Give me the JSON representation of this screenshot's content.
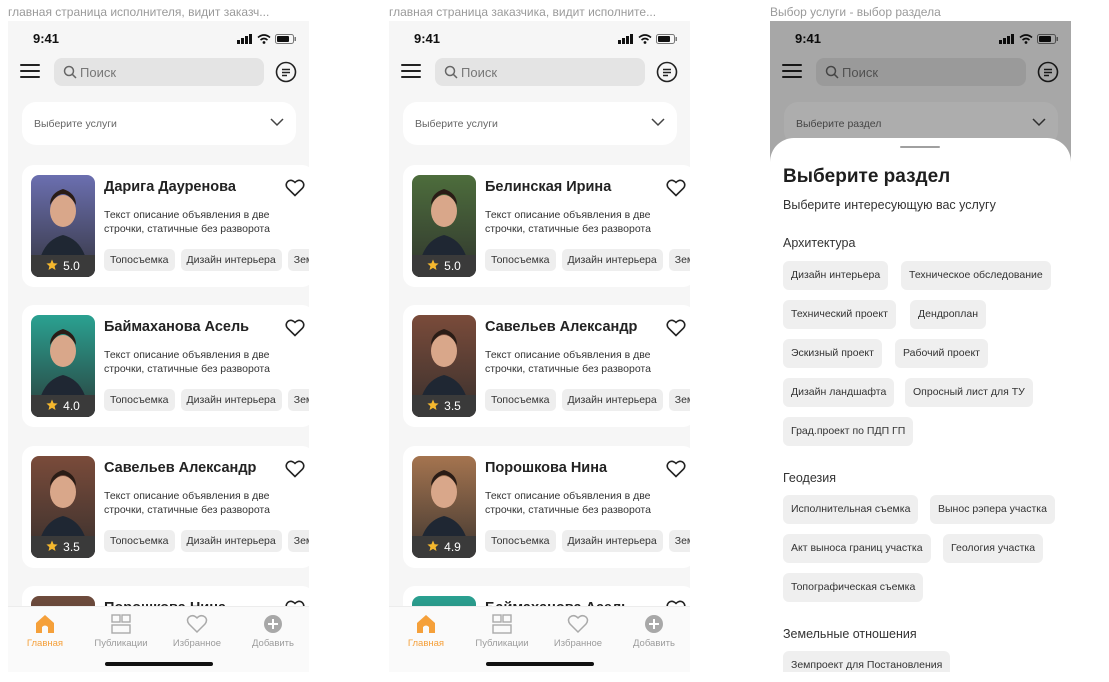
{
  "frames": [
    {
      "title": "главная страница исполнителя, видит заказч..."
    },
    {
      "title": "главная страница заказчика, видит исполните..."
    },
    {
      "title": "Выбор услуги - выбор раздела"
    }
  ],
  "status": {
    "time": "9:41"
  },
  "search": {
    "placeholder": "Поиск"
  },
  "select": {
    "services_label": "Выберите услуги",
    "section_label": "Выберите раздел"
  },
  "phone1": {
    "cards": [
      {
        "name": "Дарига Дауренова",
        "rating": "5.0",
        "photo_color": "#6b6fb0"
      },
      {
        "name": "Баймаханова Асель",
        "rating": "4.0",
        "photo_color": "#2aa191"
      },
      {
        "name": "Савельев Александр",
        "rating": "3.5",
        "photo_color": "#7a4b3a"
      },
      {
        "name": "Порошкова Нина",
        "rating": "",
        "photo_color": "#6e4b3c"
      }
    ]
  },
  "phone2": {
    "cards": [
      {
        "name": "Белинская Ирина",
        "rating": "5.0",
        "photo_color": "#4d6d3c"
      },
      {
        "name": "Савельев Александр",
        "rating": "3.5",
        "photo_color": "#7a4b3a"
      },
      {
        "name": "Порошкова Нина",
        "rating": "4.9",
        "photo_color": "#a5744f"
      },
      {
        "name": "Баймаханова Асель",
        "rating": "",
        "photo_color": "#2aa191"
      }
    ]
  },
  "card_desc": "Текст описание объявления в две строчки, статичные без разворота",
  "card_tags": [
    "Топосъемка",
    "Дизайн интерьера",
    "Земельные отношения"
  ],
  "nav": {
    "home": "Главная",
    "publications": "Публикации",
    "favorites": "Избранное",
    "add": "Добавить"
  },
  "sheet": {
    "title": "Выберите раздел",
    "subtitle": "Выберите интересующую вас услугу",
    "sections": [
      {
        "title": "Архитектура",
        "chips": [
          "Дизайн интерьера",
          "Техническое обследование",
          "Технический проект",
          "Дендроплан",
          "Эскизный проект",
          "Рабочий проект",
          "Дизайн ландшафта",
          "Опросный лист для ТУ",
          "Град.проект по ПДП ГП"
        ]
      },
      {
        "title": "Геодезия",
        "chips": [
          "Исполнительная съемка",
          "Вынос рэпера участка",
          "Акт выноса границ участка",
          "Геология участка",
          "Топографическая съемка"
        ]
      },
      {
        "title": "Земельные отношения",
        "chips": [
          "Земпроект для Постановления"
        ]
      }
    ]
  },
  "colors": {
    "accent": "#f5a03a",
    "star": "#f5b82e"
  }
}
